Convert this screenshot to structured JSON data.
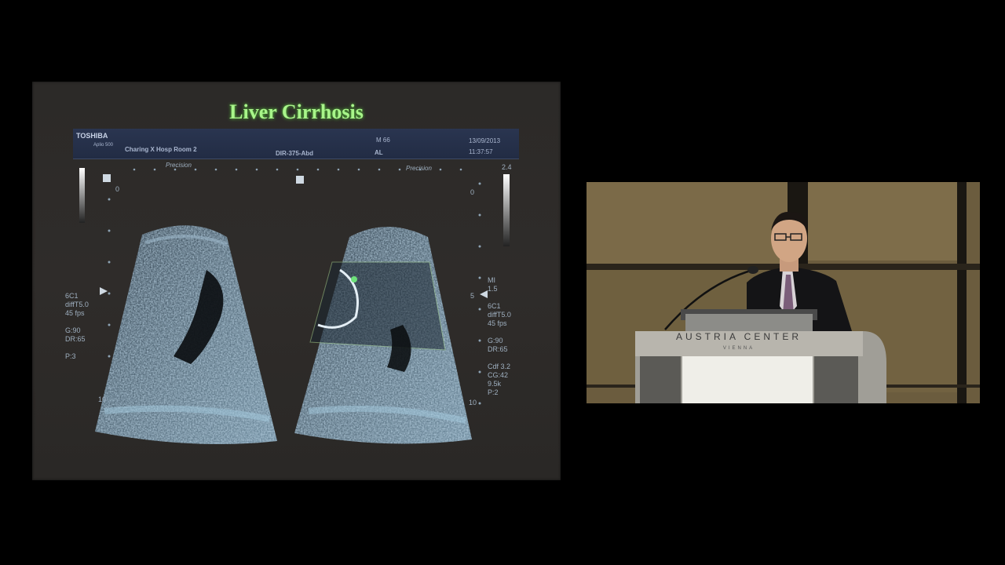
{
  "slide": {
    "title": "Liver Cirrhosis",
    "ultrasound": {
      "brand": "TOSHIBA",
      "model": "Aplio 500",
      "site": "Charing X Hosp Room 2",
      "patient": "M 66",
      "initials": "AL",
      "id": "DIR-375-Abd",
      "date": "13/09/2013",
      "time": "11:37:57",
      "precision_left": "Precision",
      "precision_right": "Precision",
      "scale_top_right": "2.4",
      "depth_zero_left": "0",
      "depth_zero_right": "0",
      "depth_five_right": "5",
      "depth_ten_left": "10",
      "depth_ten_right": "10",
      "left_params": [
        "6C1",
        "diffT5.0",
        "45 fps",
        "",
        "G:90",
        "DR:65",
        "",
        "P:3"
      ],
      "right_params": [
        "MI",
        "1.5",
        "",
        "6C1",
        "diffT5.0",
        "45 fps",
        "",
        "G:90",
        "DR:65",
        "",
        "Cdf 3.2",
        "CG:42",
        "9.5k",
        "P:2"
      ]
    }
  },
  "video": {
    "podium_brand": "AUSTRIA CENTER",
    "podium_city": "VIENNA"
  },
  "colors": {
    "title_green": "#a8f58a",
    "background": "#000000"
  }
}
